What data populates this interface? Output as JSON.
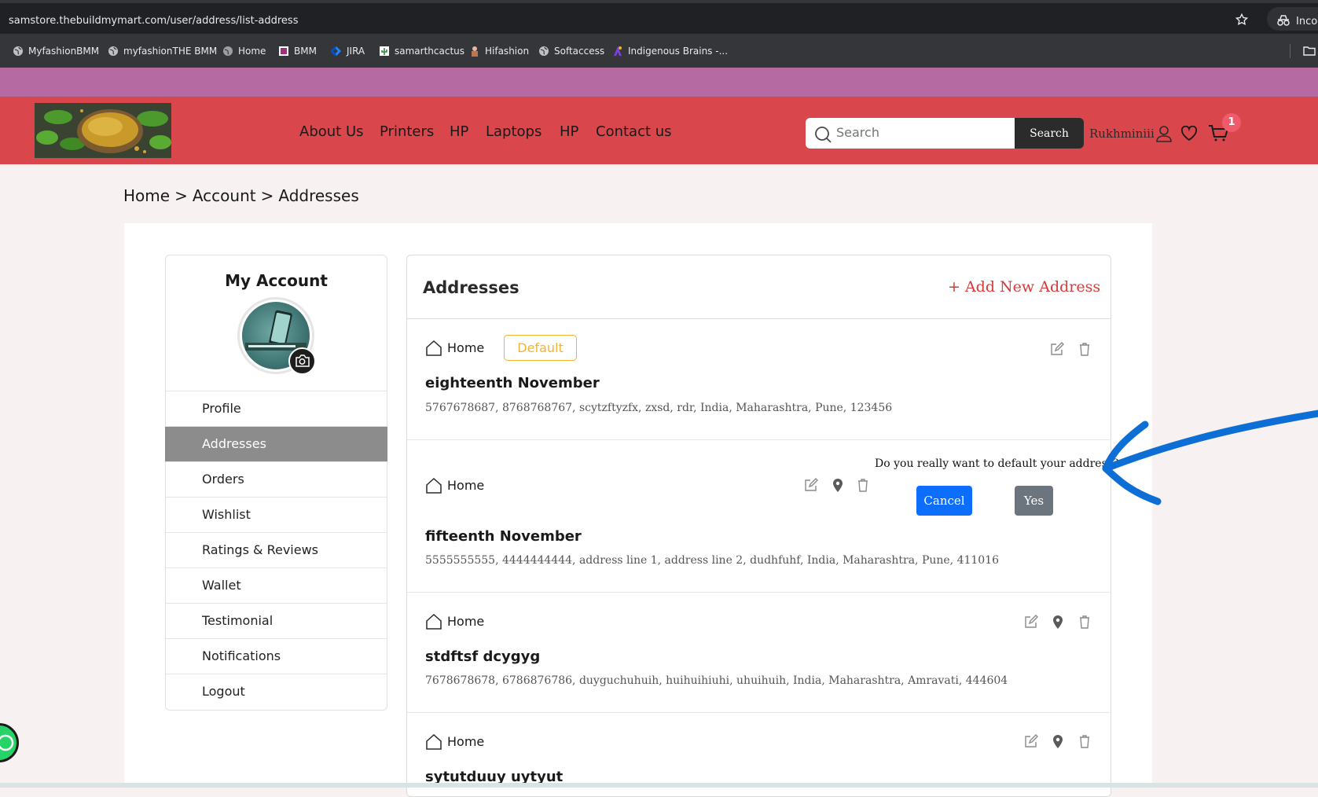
{
  "browser": {
    "url": "samstore.thebuildmymart.com/user/address/list-address",
    "incognito_label": "Incog",
    "bookmarks": [
      {
        "label": "MyfashionBMM",
        "icon": "globe-icon"
      },
      {
        "label": "myfashionTHE BMM",
        "icon": "globe-icon"
      },
      {
        "label": "Home",
        "icon": "globe-icon"
      },
      {
        "label": "BMM",
        "icon": "bmm-icon"
      },
      {
        "label": "JIRA",
        "icon": "jira-icon"
      },
      {
        "label": "samarthcactus",
        "icon": "cactus-icon"
      },
      {
        "label": "Hifashion",
        "icon": "hifashion-icon"
      },
      {
        "label": "Softaccess",
        "icon": "globe-icon"
      },
      {
        "label": "Indigenous Brains -...",
        "icon": "ib-icon"
      }
    ]
  },
  "header": {
    "nav": [
      "About Us",
      "Printers",
      "HP",
      "Laptops",
      "HP",
      "Contact us"
    ],
    "search": {
      "placeholder": "Search",
      "button": "Search"
    },
    "user_name": "Rukhminiii",
    "cart_count": "1",
    "colors": {
      "header_bg": "#d9464b",
      "promo_bg": "#b56aa2"
    }
  },
  "breadcrumb": [
    "Home",
    ">",
    "Account",
    ">",
    "Addresses"
  ],
  "sidebar": {
    "title": "My Account",
    "items": [
      "Profile",
      "Addresses",
      "Orders",
      "Wishlist",
      "Ratings & Reviews",
      "Wallet",
      "Testimonial",
      "Notifications",
      "Logout"
    ],
    "active": "Addresses"
  },
  "addresses": {
    "title": "Addresses",
    "add_new": "+ Add New Address",
    "default_badge": "Default",
    "list": [
      {
        "type": "Home",
        "name": "eighteenth November",
        "line": "5767678687, 8768768767, scytzftyzfx, zxsd, rdr, India, Maharashtra, Pune, 123456",
        "is_default": true
      },
      {
        "type": "Home",
        "name": "fifteenth November",
        "line": "5555555555, 4444444444, address line 1, address line 2, dudhfuhf, India, Maharashtra, Pune, 411016",
        "is_default": false
      },
      {
        "type": "Home",
        "name": "stdftsf dcygyg",
        "line": "7678678678, 6786876786, duyguchuhuih, huihuihiuhi, uhuihuih, India, Maharashtra, Amravati, 444604",
        "is_default": false
      },
      {
        "type": "Home",
        "name": "sytutduuy uytyut",
        "line": "",
        "is_default": false
      }
    ],
    "confirm": {
      "question": "Do you really want to default your address?",
      "cancel": "Cancel",
      "yes": "Yes"
    }
  }
}
